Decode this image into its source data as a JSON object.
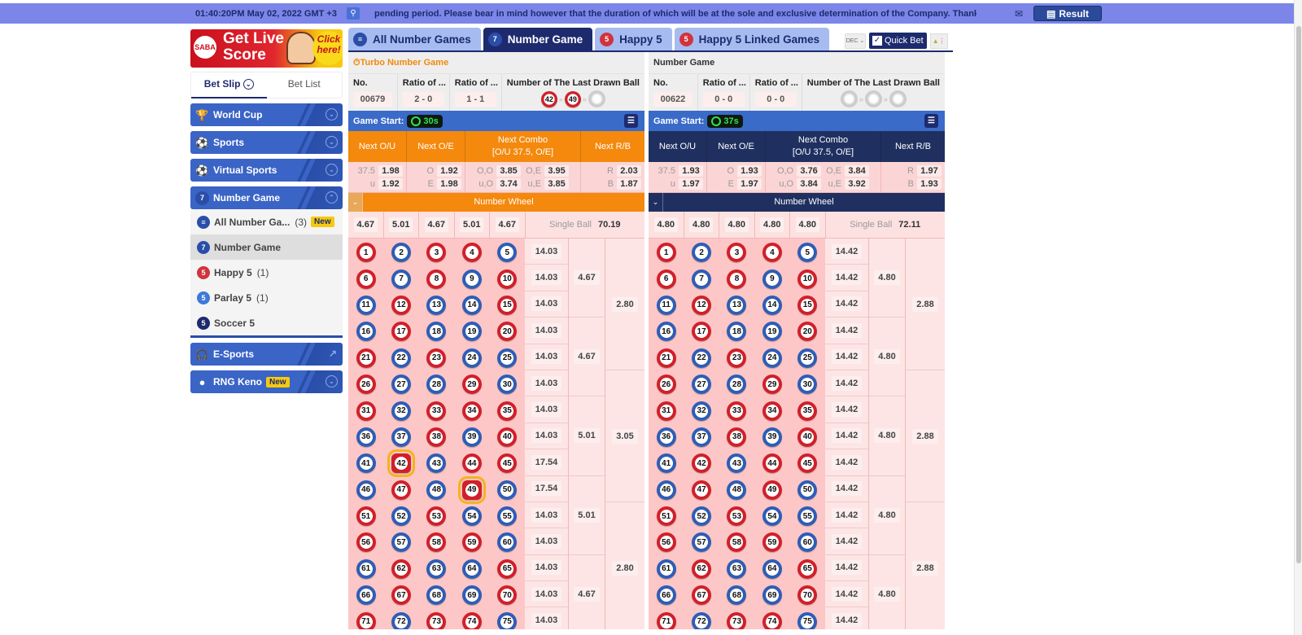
{
  "topbar": {
    "datetime": "01:40:20PM May 02, 2022 GMT +3",
    "announcement": "pending period. Please bear in mind however that the duration of which will be at the sole and exclusive determination of the Company. Thank You!",
    "result_label": "Result",
    "icons": {
      "search": "search-icon",
      "mail": "mail-icon",
      "result": "report-icon"
    }
  },
  "sidebar": {
    "banner": {
      "logo": "SABA",
      "line1": "Get Live",
      "line2": "Score",
      "cta1": "Click",
      "cta2": "here!"
    },
    "betslip_tabs": [
      {
        "label": "Bet Slip",
        "active": true
      },
      {
        "label": "Bet List",
        "active": false
      }
    ],
    "categories": [
      {
        "label": "World Cup",
        "icon": "trophy-icon"
      },
      {
        "label": "Sports",
        "icon": "sports-balls-icon"
      },
      {
        "label": "Virtual Sports",
        "icon": "virtual-sports-icon"
      },
      {
        "label": "Number Game",
        "icon": "number-game-icon",
        "expanded": true
      },
      {
        "label": "E-Sports",
        "icon": "headset-icon"
      },
      {
        "label": "RNG Keno",
        "icon": "keno-icon",
        "badge": "New"
      }
    ],
    "number_game_items": [
      {
        "label": "All Number Ga...",
        "count": "(3)",
        "badge": "New"
      },
      {
        "label": "Number Game",
        "count": "",
        "selected": true
      },
      {
        "label": "Happy 5",
        "count": "(1)"
      },
      {
        "label": "Parlay 5",
        "count": "(1)"
      },
      {
        "label": "Soccer 5",
        "count": ""
      }
    ]
  },
  "main": {
    "tabs": [
      {
        "label": "All Number Games",
        "active": false
      },
      {
        "label": "Number Game",
        "active": true
      },
      {
        "label": "Happy 5",
        "active": false
      },
      {
        "label": "Happy 5 Linked Games",
        "active": false
      }
    ],
    "tools": {
      "odds_format": "DEC",
      "quick_bet": "Quick Bet",
      "quick_bet_checked": true
    },
    "headers": {
      "no": "No.",
      "ratio1": "Ratio of ...",
      "ratio2": "Ratio of ...",
      "last_drawn": "Number of The Last Drawn Ball",
      "game_start": "Game Start:",
      "next_ou": "Next O/U",
      "next_oe": "Next O/E",
      "next_combo": "Next Combo",
      "combo_sub": "[O/U 37.5, O/E]",
      "next_rb": "Next R/B",
      "number_wheel": "Number Wheel",
      "single_ball": "Single Ball"
    },
    "panels": [
      {
        "title": "Turbo Number Game",
        "no": "00679",
        "ratio1": "2 - 0",
        "ratio2": "1 - 1",
        "last_balls": [
          "42",
          "49",
          ""
        ],
        "timer": "30s",
        "ou": {
          "line": "37.5",
          "over": "1.98",
          "u_label": "u",
          "under": "1.92"
        },
        "oe": {
          "o_label": "O",
          "odd": "1.92",
          "e_label": "E",
          "even": "1.98"
        },
        "combo": {
          "oo": "3.85",
          "oe": "3.95",
          "uo": "3.74",
          "ue": "3.85"
        },
        "rb": {
          "r": "2.03",
          "b": "1.87"
        },
        "wheel": [
          "4.67",
          "5.01",
          "4.67",
          "5.01",
          "4.67"
        ],
        "single_ball": "70.19",
        "highlighted": [
          42,
          49
        ],
        "row_odds": [
          "14.03",
          "14.03",
          "14.03",
          "14.03",
          "14.03",
          "14.03",
          "14.03",
          "14.03",
          "17.54",
          "17.54",
          "14.03",
          "14.03",
          "14.03",
          "14.03",
          "14.03"
        ],
        "group3": [
          "4.67",
          "4.67",
          "5.01",
          "5.01",
          "4.67"
        ],
        "group_big": [
          "2.80",
          "3.05",
          "2.80"
        ]
      },
      {
        "title": "Number Game",
        "no": "00622",
        "ratio1": "0 - 0",
        "ratio2": "0 - 0",
        "last_balls": [
          "",
          "",
          ""
        ],
        "timer": "37s",
        "ou": {
          "line": "37.5",
          "over": "1.93",
          "u_label": "u",
          "under": "1.97"
        },
        "oe": {
          "o_label": "O",
          "odd": "1.93",
          "e_label": "E",
          "even": "1.97"
        },
        "combo": {
          "oo": "3.76",
          "oe": "3.84",
          "uo": "3.84",
          "ue": "3.92"
        },
        "rb": {
          "r": "1.97",
          "b": "1.93"
        },
        "wheel": [
          "4.80",
          "4.80",
          "4.80",
          "4.80",
          "4.80"
        ],
        "single_ball": "72.11",
        "highlighted": [],
        "row_odds": [
          "14.42",
          "14.42",
          "14.42",
          "14.42",
          "14.42",
          "14.42",
          "14.42",
          "14.42",
          "14.42",
          "14.42",
          "14.42",
          "14.42",
          "14.42",
          "14.42",
          "14.42"
        ],
        "group3": [
          "4.80",
          "4.80",
          "4.80",
          "4.80",
          "4.80"
        ],
        "group_big": [
          "2.88",
          "2.88",
          "2.88"
        ]
      }
    ],
    "ball_colors": [
      "R",
      "B",
      "R",
      "R",
      "B",
      "R",
      "B",
      "R",
      "B",
      "R",
      "B",
      "R",
      "B",
      "B",
      "R",
      "B",
      "R",
      "B",
      "B",
      "R",
      "R",
      "B",
      "R",
      "B",
      "B",
      "R",
      "B",
      "B",
      "R",
      "B",
      "R",
      "B",
      "R",
      "R",
      "R",
      "B",
      "B",
      "R",
      "B",
      "R",
      "B",
      "R",
      "B",
      "R",
      "R",
      "B",
      "R",
      "B",
      "R",
      "B",
      "R",
      "B",
      "R",
      "B",
      "B",
      "R",
      "B",
      "R",
      "R",
      "B",
      "B",
      "R",
      "B",
      "B",
      "R",
      "B",
      "R",
      "B",
      "B",
      "R",
      "R",
      "B",
      "R",
      "R",
      "B"
    ]
  }
}
